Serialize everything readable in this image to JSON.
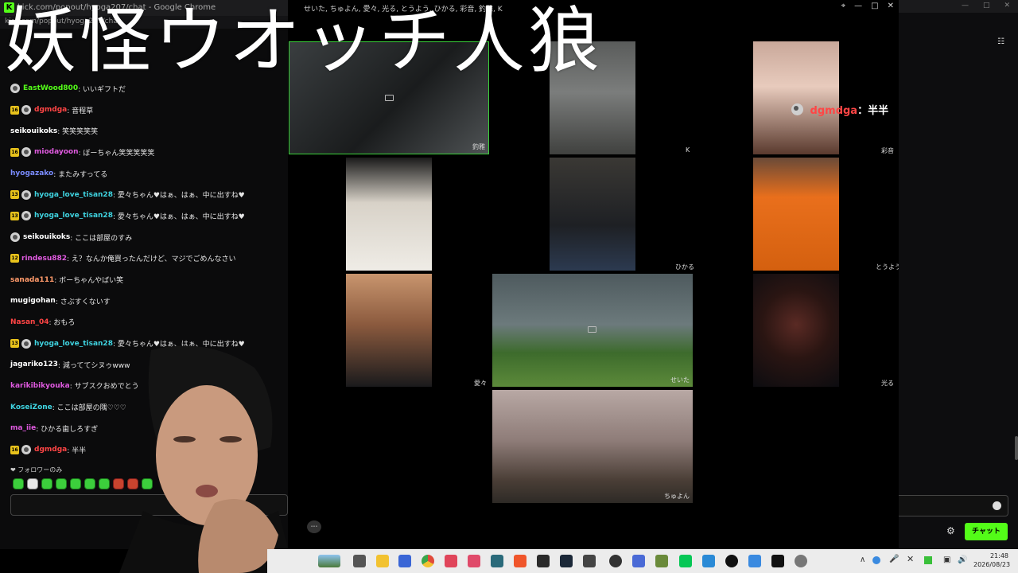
{
  "stream_title": "妖怪ウオッチ人狼",
  "chat_window": {
    "title": "kick.com/popout/hyoga207/chat - Google Chrome",
    "url": "kick.com/popout/hyoga207/chat"
  },
  "chat_messages": [
    {
      "user": "EastWood800",
      "text": ": いいギフトだ",
      "color": "#53fc18",
      "badges": [
        "og"
      ]
    },
    {
      "user": "dgmdga",
      "text": ": 音程草",
      "color": "#ff4545",
      "badges": [
        "sub",
        "og"
      ],
      "sub_months": "16"
    },
    {
      "user": "seikouikoks",
      "text": ": 笑笑笑笑笑",
      "color": "#ffffff",
      "badges": []
    },
    {
      "user": "miodayoon",
      "text": ": ぼーちゃん笑笑笑笑笑",
      "color": "#e05ae0",
      "badges": [
        "sub",
        "og"
      ],
      "sub_months": "16"
    },
    {
      "user": "hyogazako",
      "text": ": またみすってる",
      "color": "#7a8cff",
      "badges": []
    },
    {
      "user": "hyoga_love_tisan28",
      "text": ": 愛々ちゃん♥はぁ、はぁ、中に出すね♥",
      "color": "#3fd3e0",
      "badges": [
        "sub",
        "og"
      ],
      "sub_months": "13"
    },
    {
      "user": "hyoga_love_tisan28",
      "text": ": 愛々ちゃん♥はぁ、はぁ、中に出すね♥",
      "color": "#3fd3e0",
      "badges": [
        "sub",
        "og"
      ],
      "sub_months": "13"
    },
    {
      "user": "seikouikoks",
      "text": ": ここは部屋のすみ",
      "color": "#ffffff",
      "badges": [
        "og"
      ]
    },
    {
      "user": "rindesu882",
      "text": ": え？なんか俺買ったんだけど、マジでごめんなさい",
      "color": "#e05ae0",
      "badges": [
        "sub"
      ],
      "sub_months": "12"
    },
    {
      "user": "sanada111",
      "text": ": ボーちゃんやばい笑",
      "color": "#ff9a6a",
      "badges": []
    },
    {
      "user": "mugigohan",
      "text": ": さぶすくないす",
      "color": "#ffffff",
      "badges": []
    },
    {
      "user": "Nasan_04",
      "text": ": おもろ",
      "color": "#ff4545",
      "badges": []
    },
    {
      "user": "hyoga_love_tisan28",
      "text": ": 愛々ちゃん♥はぁ、はぁ、中に出すね♥",
      "color": "#3fd3e0",
      "badges": [
        "sub",
        "og"
      ],
      "sub_months": "13"
    },
    {
      "user": "jagariko123",
      "text": ": 減っててシヌゥwww",
      "color": "#ffffff",
      "badges": []
    },
    {
      "user": "karikibikyouka",
      "text": ": サブスクおめでとう",
      "color": "#e05ae0",
      "badges": []
    },
    {
      "user": "KoseiZone",
      "text": ": ここは部屋の隅♡♡♡",
      "color": "#3fd3e0",
      "badges": []
    },
    {
      "user": "ma_iie",
      "text": ": ひかる歯しろすぎ",
      "color": "#e05ae0",
      "badges": []
    },
    {
      "user": "dgmdga",
      "text": ": 半半",
      "color": "#ff4545",
      "badges": [
        "sub",
        "og"
      ],
      "sub_months": "16"
    }
  ],
  "follower_only_label": "❤ フォロワーのみ",
  "call_window": {
    "title": "せいた, ちゅよん, 愛々, 光る, とうよう, ひかる, 彩音, 釣雅, K"
  },
  "participants": [
    {
      "name": "釣雅",
      "active": true
    },
    {
      "name": "K"
    },
    {
      "name": "彩音"
    },
    {
      "name": "ひかる"
    },
    {
      "name": "とうよう"
    },
    {
      "name": "愛々"
    },
    {
      "name": "せいた",
      "muted": true
    },
    {
      "name": "光る",
      "muted": true
    },
    {
      "name": "ちゅよん"
    }
  ],
  "highlight_chat": {
    "user": "dgmdga",
    "text": "：半半",
    "color": "#ff4545"
  },
  "right_pane": {
    "chat_button": "チャット"
  },
  "taskbar": {
    "time": "21:48",
    "date": "2026/08/23"
  },
  "colors": {
    "kick_green": "#53fc18",
    "active_tile_border": "#3ad13a"
  }
}
